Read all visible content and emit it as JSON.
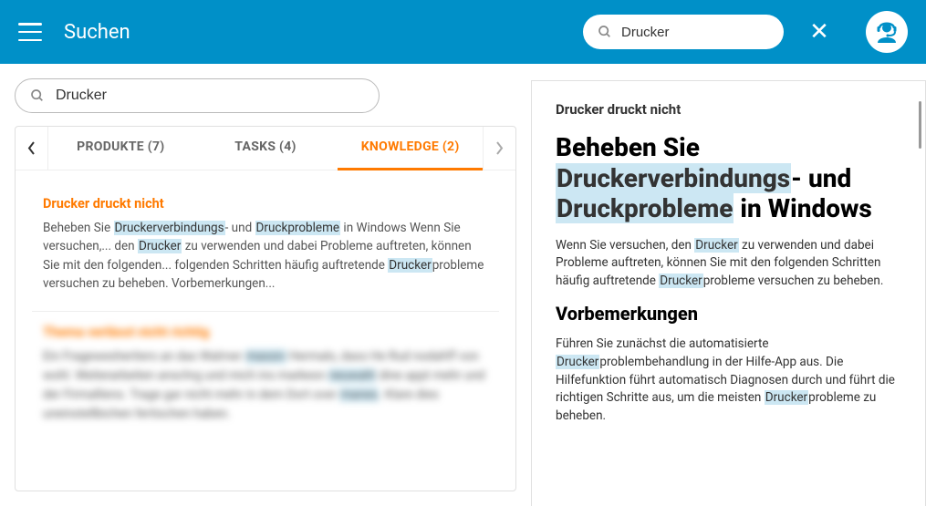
{
  "header": {
    "title": "Suchen",
    "search_value": "Drucker"
  },
  "main_search": {
    "value": "Drucker"
  },
  "tabs": {
    "items": [
      {
        "label": "PRODUKTE (7)"
      },
      {
        "label": "TASKS (4)"
      },
      {
        "label": "KNOWLEDGE (2)"
      }
    ]
  },
  "results": {
    "items": [
      {
        "title": "Drucker druckt nicht",
        "body_before": "Beheben Sie ",
        "hl1": "Druckerverbindungs",
        "body_mid1": "- und ",
        "hl2": "Druckprobleme",
        "body_mid2": " in Windows Wenn Sie versuchen,... den ",
        "hl3": "Drucker",
        "body_mid3": " zu verwenden und dabei Probleme auftreten, können Sie mit den folgenden... folgenden Schritten häufig auftretende ",
        "hl4": "Drucker",
        "body_after": "probleme versuchen zu beheben. Vorbemerkungen..."
      }
    ]
  },
  "article": {
    "subtitle": "Drucker druckt nicht",
    "title_p1": "Beheben Sie ",
    "title_hl1": "Druckerverbindungs",
    "title_p2": "- und ",
    "title_hl2": "Druckprobleme",
    "title_p3": " in Windows",
    "para1_p1": "Wenn Sie versuchen, den ",
    "para1_hl1": "Drucker",
    "para1_p2": " zu verwenden und dabei Probleme auftreten, können Sie mit den folgenden Schritten häufig auftretende ",
    "para1_hl2": "Drucker",
    "para1_p3": "probleme versuchen zu beheben.",
    "h2": "Vorbemerkungen",
    "para2_p1": "Führen Sie zunächst die automatisierte ",
    "para2_hl1": "Drucker",
    "para2_p2": "problembehandlung in der Hilfe-App aus. Die Hilfefunktion führt automatisch Diagnosen durch und führt die richtigen Schritte aus, um die meisten ",
    "para2_hl2": "Drucker",
    "para2_p3": "probleme zu beheben."
  }
}
